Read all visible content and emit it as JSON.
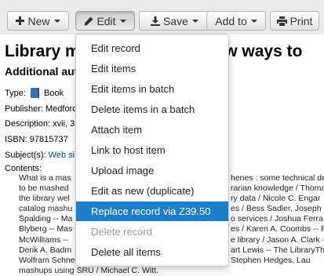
{
  "toolbar": {
    "new_label": "New",
    "edit_label": "Edit",
    "save_label": "Save",
    "add_to_label": "Add to",
    "print_label": "Print"
  },
  "record": {
    "title_start": "Library m",
    "title_end": "new ways to",
    "author_label": "Additional auth",
    "type_label": "Type:",
    "type_value": "Book",
    "publisher_label": "Publisher:",
    "publisher_value": "Medford",
    "description_label": "Description:",
    "description_value": "xvii, 3",
    "isbn_label": "ISBN:",
    "isbn_value": "97815737",
    "subjects_label": "Subject(s):",
    "subjects_value": "Web si",
    "contents_label": "Contents:",
    "contents_lines": [
      [
        "What is a mas",
        "henes : some technical deta"
      ],
      [
        "to be mashed",
        "rarian knowledge / Thoma"
      ],
      [
        "the library wel",
        "ry data / Nicole C. Engar"
      ],
      [
        "catalog mashu",
        "es / Bess Sadler, Joseph C"
      ],
      [
        "Spalding -- Ma",
        "o services / Joshua Ferra"
      ],
      [
        "Blyberg -- Mas",
        "es / Karen A. Coombs -- F"
      ],
      [
        "McWilliams --",
        "e library / Jason A. Clark -"
      ],
      [
        "Derik A. Badm",
        "art Lewis -- The LibraryTh"
      ],
      [
        "Wolfram Schne",
        "Stephen Hedges, Lau"
      ],
      [
        "mashups using SRU / Michael C. Witt.",
        ""
      ]
    ]
  },
  "edit_menu": {
    "items": [
      {
        "label": "Edit record",
        "state": "normal"
      },
      {
        "label": "Edit items",
        "state": "normal"
      },
      {
        "label": "Edit items in batch",
        "state": "normal"
      },
      {
        "label": "Delete items in a batch",
        "state": "normal"
      },
      {
        "label": "Attach item",
        "state": "normal"
      },
      {
        "label": "Link to host item",
        "state": "normal"
      },
      {
        "label": "Upload image",
        "state": "normal"
      },
      {
        "label": "Edit as new (duplicate)",
        "state": "normal"
      },
      {
        "label": "Replace record via Z39.50",
        "state": "highlighted"
      },
      {
        "label": "Delete record",
        "state": "disabled"
      },
      {
        "label": "Delete all items",
        "state": "normal"
      }
    ]
  },
  "colors": {
    "highlight": "#1a7ecb",
    "link": "#004b8d",
    "toolbar_bg": "#eaeaea"
  },
  "icons": [
    "plus-icon",
    "pencil-icon",
    "download-icon",
    "printer-icon",
    "book-icon",
    "caret-down-icon"
  ]
}
